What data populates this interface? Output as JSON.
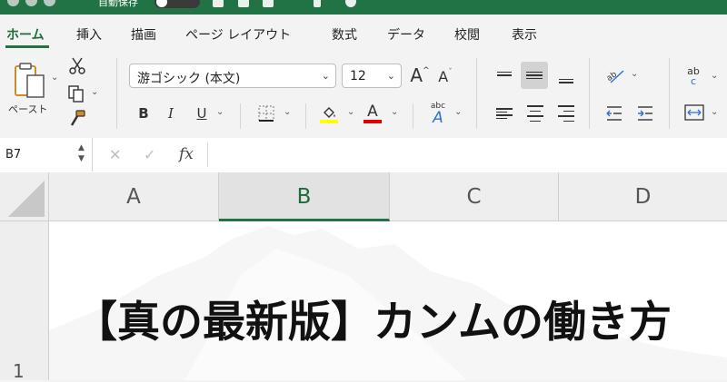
{
  "titlebar": {
    "autosave_label": "自動保存",
    "accent_color": "#217346"
  },
  "menu": {
    "tabs": [
      "ホーム",
      "挿入",
      "描画",
      "ページ レイアウト",
      "数式",
      "データ",
      "校閲",
      "表示"
    ],
    "active_tab": "ホーム"
  },
  "ribbon": {
    "paste_label": "ペースト",
    "font_name": "游ゴシック (本文)",
    "font_size": "12",
    "bold": "B",
    "italic": "I",
    "underline": "U",
    "font_color_letter": "A",
    "phonetic_small": "abc",
    "phonetic_big": "A",
    "grow_font": "A",
    "shrink_font": "A",
    "wrap_text": "ab",
    "wrap_text_2": "c",
    "highlight_color": "#ffff00",
    "font_color": "#e00000"
  },
  "formula_bar": {
    "name_box": "B7",
    "cancel_icon": "x-icon",
    "enter_icon": "check-icon",
    "fx": "fx",
    "value": ""
  },
  "sheet": {
    "columns": [
      "A",
      "B",
      "C",
      "D"
    ],
    "selected_column": "B",
    "rows": [
      "1"
    ],
    "headline": "【真の最新版】カンムの働き方"
  }
}
